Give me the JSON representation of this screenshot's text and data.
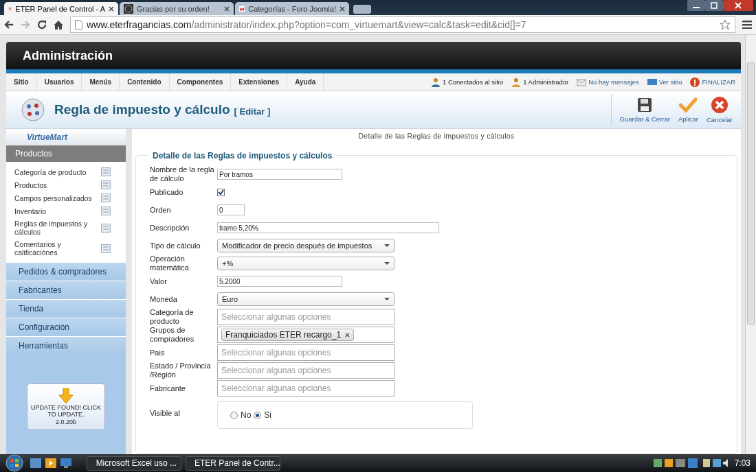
{
  "browser": {
    "tabs": [
      {
        "title": "ETER Panel de Control - A",
        "selected": true
      },
      {
        "title": "Gracias por su orden!",
        "selected": false
      },
      {
        "title": "Categorías - Foro Joomla!",
        "selected": false
      }
    ],
    "url": {
      "host": "www.eterfragancias.com",
      "path": "/administrator/index.php?option=com_virtuemart&view=calc&task=edit&cid[]=7"
    }
  },
  "header": {
    "title": "Administración"
  },
  "menu": [
    "Sitio",
    "Usuarios",
    "Menús",
    "Contenido",
    "Componentes",
    "Extensiones",
    "Ayuda"
  ],
  "status": [
    {
      "kind": "users",
      "text": "1 Conectados al sitio"
    },
    {
      "kind": "admin",
      "text": "1 Administrador"
    },
    {
      "kind": "mail",
      "text": "No hay mensajes"
    },
    {
      "kind": "site",
      "text": "Ver sitio"
    },
    {
      "kind": "logout",
      "text": "FINALIZAR"
    }
  ],
  "page_title": {
    "title": "Regla de impuesto y cálculo",
    "tag": "[ Editar ]"
  },
  "toolbar": [
    {
      "kind": "save",
      "label": "Guardar & Cerrar"
    },
    {
      "kind": "apply",
      "label": "Aplicar"
    },
    {
      "kind": "cancel",
      "label": "Cancelar"
    }
  ],
  "sidebar": {
    "logo": "VirtueMart",
    "section": "Productos",
    "items": [
      {
        "label": "Categoría de producto"
      },
      {
        "label": "Productos"
      },
      {
        "label": "Campos personalizados"
      },
      {
        "label": "Inventario"
      },
      {
        "label": "Reglas de impuestos y cálculos"
      },
      {
        "label": "Comentarios y calificaciónes"
      }
    ],
    "sections": [
      "Pedidos & compradores",
      "Fabricantes",
      "Tienda",
      "Configuración",
      "Herramientas"
    ],
    "update": {
      "text": "UPDATE FOUND! CLICK TO UPDATE.",
      "version": "2.0.20b"
    }
  },
  "form": {
    "heading": "Detalle de las Reglas de impuestos y cálculos",
    "legend": "Detalle de las Reglas de impuestos y cálculos",
    "fields": [
      {
        "label": "Nombre de la regla de cálculo",
        "kind": "text",
        "value": "Por tramos"
      },
      {
        "label": "Publicado",
        "kind": "checkbox",
        "checked": true
      },
      {
        "label": "Orden",
        "kind": "short",
        "value": "0"
      },
      {
        "label": "Descripción",
        "kind": "long",
        "value": "tramo 5,20%"
      },
      {
        "label": "Tipo de cálculo",
        "kind": "select",
        "value": "Modificador de precio después de impuestos"
      },
      {
        "label": "Operación matemática",
        "kind": "select",
        "value": "+%"
      },
      {
        "label": "Valor",
        "kind": "text",
        "value": "5.2000"
      },
      {
        "label": "Moneda",
        "kind": "select",
        "value": "Euro"
      },
      {
        "label": "Categoría de producto",
        "kind": "multi",
        "placeholder": "Seleccionar algunas opciones"
      },
      {
        "label": "Grupos de compradores",
        "kind": "tags",
        "tags": [
          "Franquiciados ETER recargo_1"
        ]
      },
      {
        "label": "Pais",
        "kind": "multi",
        "placeholder": "Seleccionar algunas opciones"
      },
      {
        "label": "Estado / Provincia /Región",
        "kind": "multi",
        "placeholder": "Seleccionar algunas opciones"
      },
      {
        "label": "Fabricante",
        "kind": "multi",
        "placeholder": "Seleccionar algunas opciones"
      },
      {
        "label": "Visible al",
        "kind": "radio",
        "options": [
          {
            "label": "No",
            "selected": false
          },
          {
            "label": "Si",
            "selected": true
          }
        ]
      }
    ]
  },
  "taskbar": {
    "items": [
      "Microsoft Excel uso ...",
      "ETER Panel de Contr..."
    ],
    "clock": "7:03"
  }
}
